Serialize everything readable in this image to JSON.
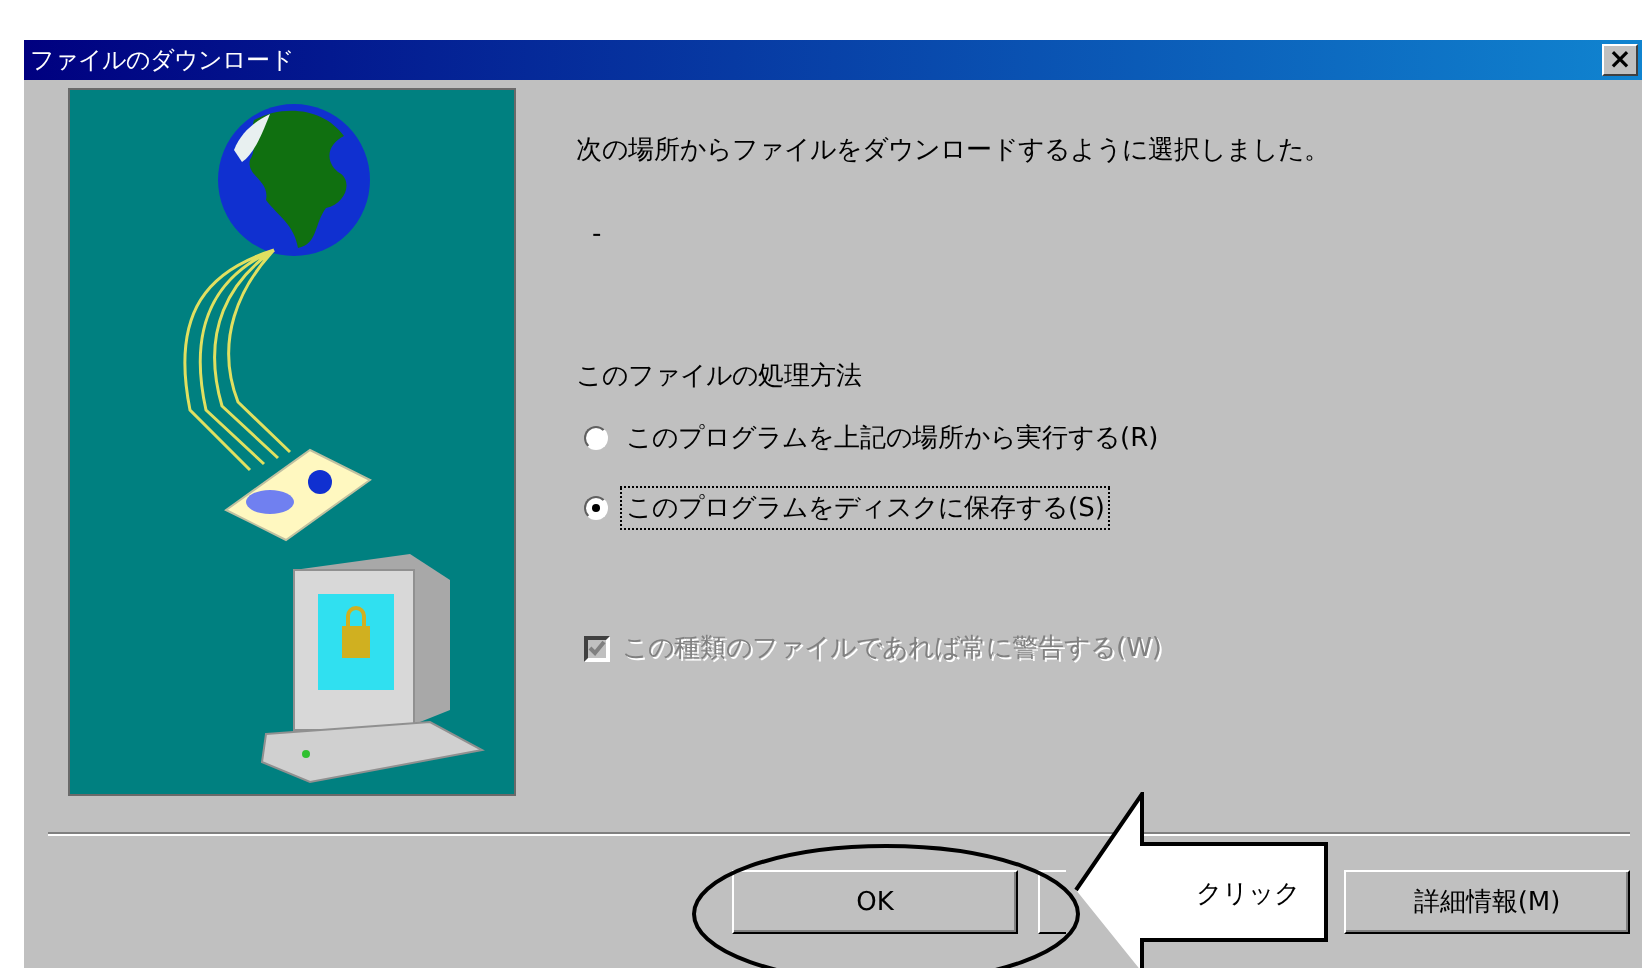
{
  "window": {
    "title": "ファイルのダウンロード",
    "close": "×"
  },
  "message": "次の場所からファイルをダウンロードするように選択しました。",
  "location": "-",
  "question": "このファイルの処理方法",
  "options": [
    {
      "label": "このプログラムを上記の場所から実行する(R)",
      "selected": false,
      "focused": false
    },
    {
      "label": "このプログラムをディスクに保存する(S)",
      "selected": true,
      "focused": true
    }
  ],
  "warn_checkbox": {
    "label": "この種類のファイルであれば常に警告する(W)",
    "checked": true,
    "disabled": true
  },
  "buttons": [
    {
      "kind": "push",
      "label": "OK"
    },
    {
      "kind": "covered"
    },
    {
      "kind": "push",
      "label": "詳細情報(M)"
    }
  ],
  "annotation": {
    "label": "クリック"
  }
}
